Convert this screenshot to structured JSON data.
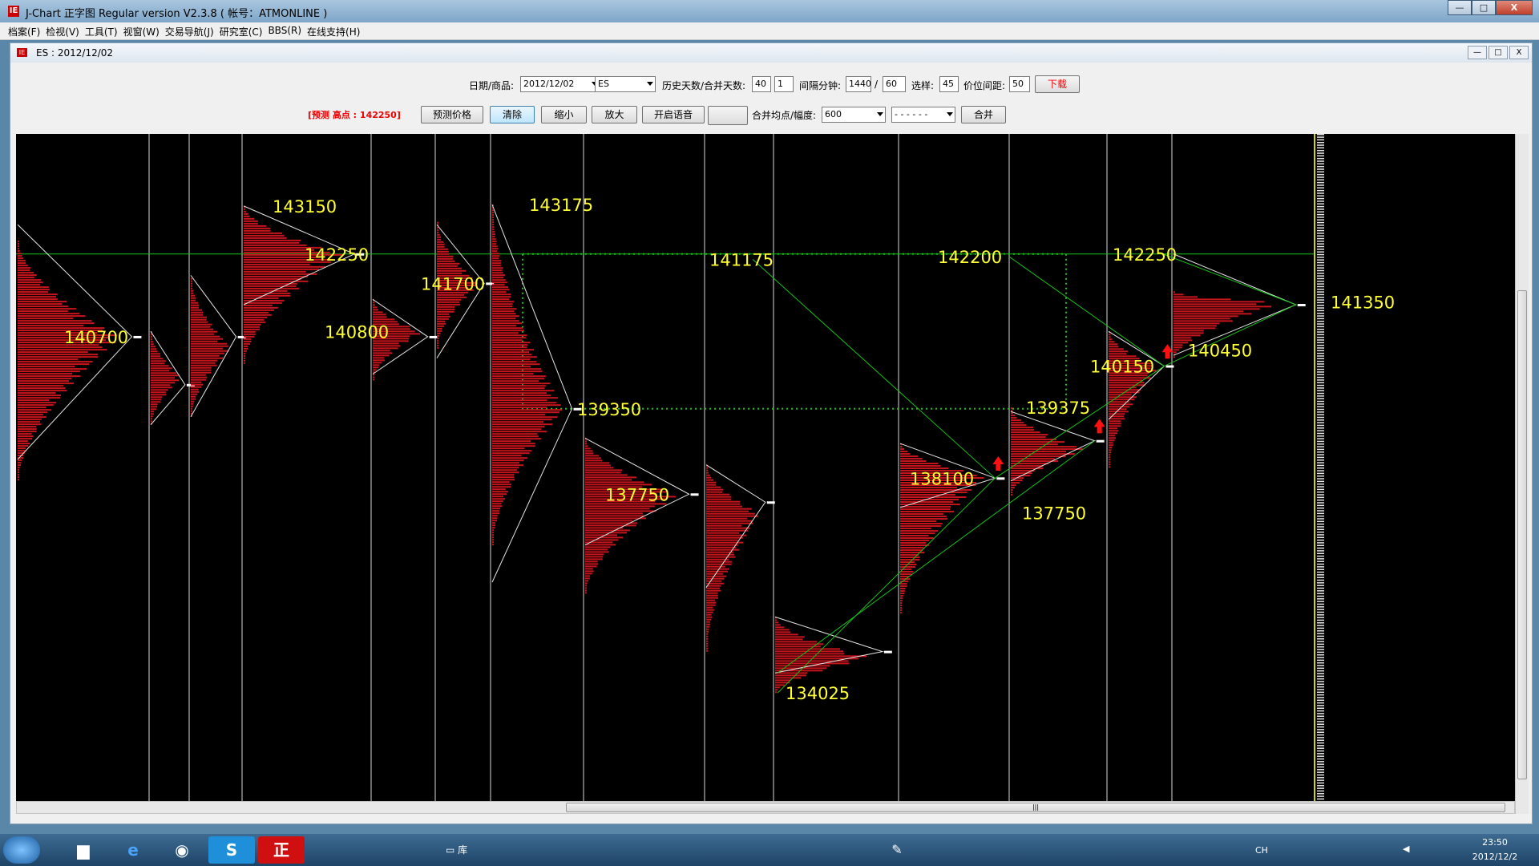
{
  "window": {
    "title": "J-Chart 正字图  Regular version V2.3.8    ( 帐号：ATMONLINE )",
    "app_icon": "IE",
    "buttons": [
      "—",
      "□",
      "X"
    ]
  },
  "menu": [
    "档案(F)",
    "检视(V)",
    "工具(T)",
    "视窗(W)",
    "交易导航(J)",
    "研究室(C)",
    "BBS(R)",
    "在线支持(H)"
  ],
  "child": {
    "title": "ES : 2012/12/02",
    "buttons": [
      "—",
      "□",
      "X"
    ]
  },
  "toolbar1": {
    "date_label": "日期/商品:",
    "date_value": "2012/12/02",
    "symbol_value": "ES",
    "history_label": "历史天数/合并天数:",
    "history_value": "40",
    "merge_value": "1",
    "interval_label": "间隔分钟:",
    "interval_a": "1440",
    "interval_sep": "/",
    "interval_b": "60",
    "choice_label": "选样:",
    "choice_value": "45",
    "price_gap_label": "价位间距:",
    "price_gap_value": "50",
    "download_button": "下载"
  },
  "toolbar2": {
    "forecast_text": "[预测  高点 :  142250]",
    "predict_button": "预测价格",
    "clear_button": "清除",
    "zoom_out_button": "缩小",
    "zoom_in_button": "放大",
    "voice_button": "开启语音",
    "blank_button": "",
    "avg_label": "合并均点/幅度:",
    "avg_value": "600",
    "dash_value": "- - - - - -",
    "merge_button": "合并"
  },
  "chart_data": {
    "type": "market-profile",
    "ylim": [
      132000,
      144500
    ],
    "reference_level": 142250,
    "box": {
      "from": 139350,
      "to": 142250
    },
    "columns": [
      {
        "label": "140700",
        "high": 142500,
        "low": 138000,
        "mode": 140700,
        "apex": 140700,
        "apex_top": 142800,
        "apex_bot": 138400
      },
      {
        "label": "",
        "high": 140800,
        "low": 139050,
        "mode": 139950,
        "apex": 139800,
        "apex_top": 140800,
        "apex_bot": 139050
      },
      {
        "label": "",
        "high": 141800,
        "low": 139200,
        "mode": 140500,
        "apex": 140700,
        "apex_top": 141850,
        "apex_bot": 139200
      },
      {
        "label": "143150",
        "high": 143150,
        "low": 140200,
        "mode": 142250,
        "apex": 142250,
        "apex_top": 143150,
        "apex_bot": 141300,
        "label_value": 142250
      },
      {
        "label": "140800",
        "high": 141400,
        "low": 139900,
        "mode": 140800,
        "apex": 140700,
        "apex_top": 141400,
        "apex_bot": 140000
      },
      {
        "label": "141700",
        "high": 142850,
        "low": 140500,
        "mode": 141700,
        "apex": 141700,
        "apex_top": 142800,
        "apex_bot": 140300
      },
      {
        "label": "143175",
        "high": 143175,
        "low": 136800,
        "mode": 139350,
        "apex": 139350,
        "apex_top": 143175,
        "apex_bot": 136100
      },
      {
        "label": "137750",
        "high": 138800,
        "low": 135900,
        "mode": 137750,
        "apex": 137750,
        "apex_top": 138800,
        "apex_bot": 136800
      },
      {
        "label": "",
        "high": 138300,
        "low": 134800,
        "mode": 137400,
        "apex": 137600,
        "apex_top": 138300,
        "apex_bot": 136000
      },
      {
        "label": "134025",
        "high": 135450,
        "low": 134025,
        "mode": 134700,
        "apex": 134800,
        "apex_top": 135450,
        "apex_bot": 134400
      },
      {
        "label": "138100",
        "high": 138700,
        "low": 135500,
        "mode": 138100,
        "apex": 138050,
        "apex_top": 138700,
        "apex_bot": 137500
      },
      {
        "label": "139375",
        "high": 139375,
        "low": 137750,
        "mode": 138600,
        "apex": 138750,
        "apex_top": 139300,
        "apex_bot": 138000
      },
      {
        "label": "140150",
        "high": 140800,
        "low": 138250,
        "mode": 140150,
        "apex": 140150,
        "apex_top": 140800,
        "apex_bot": 139150
      },
      {
        "label": "140450",
        "high": 141550,
        "low": 140300,
        "mode": 141350,
        "apex": 141300,
        "apex_top": 142250,
        "apex_bot": 140350
      }
    ],
    "annotations": [
      {
        "text": "140700",
        "value": 140700
      },
      {
        "text": "143150",
        "value": 143150
      },
      {
        "text": "142250",
        "value": 142250
      },
      {
        "text": "140800",
        "value": 140800
      },
      {
        "text": "141700",
        "value": 141700
      },
      {
        "text": "143175",
        "value": 143175
      },
      {
        "text": "139350",
        "value": 139350
      },
      {
        "text": "141175",
        "value": 142150
      },
      {
        "text": "137750",
        "value": 137750
      },
      {
        "text": "134025",
        "value": 134025
      },
      {
        "text": "138100",
        "value": 138050
      },
      {
        "text": "142200",
        "value": 142200
      },
      {
        "text": "139375",
        "value": 139375
      },
      {
        "text": "137750",
        "value": 137400
      },
      {
        "text": "140150",
        "value": 140150
      },
      {
        "text": "142250",
        "value": 142250
      },
      {
        "text": "140450",
        "value": 140450
      },
      {
        "text": "141350",
        "value": 141350
      }
    ],
    "arrows": 3,
    "colors": {
      "profile": "#c8141c",
      "label": "#ffff33",
      "guide": "#18c018",
      "apex": "#e6e6e6",
      "axis": "#d4d400"
    }
  },
  "taskbar": {
    "library_label": "库",
    "lang": "CH",
    "time": "23:50",
    "date": "2012/12/2"
  }
}
